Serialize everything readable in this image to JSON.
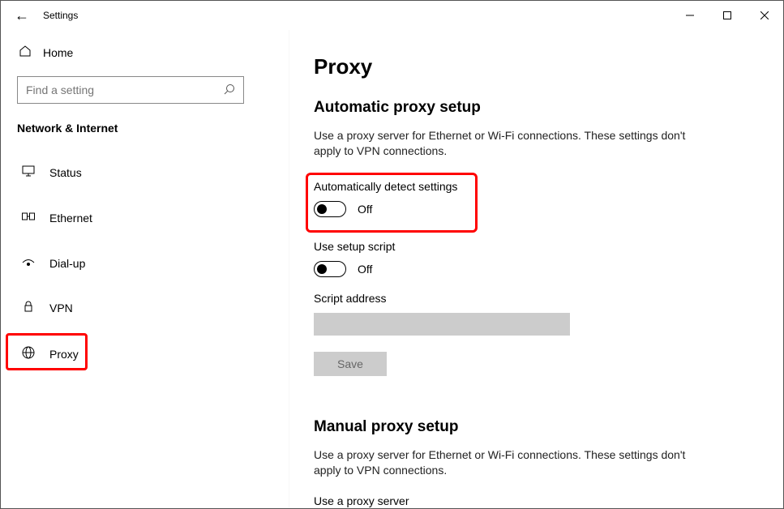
{
  "titlebar": {
    "title": "Settings"
  },
  "sidebar": {
    "home": "Home",
    "search_placeholder": "Find a setting",
    "category": "Network & Internet",
    "items": [
      {
        "label": "Status"
      },
      {
        "label": "Ethernet"
      },
      {
        "label": "Dial-up"
      },
      {
        "label": "VPN"
      },
      {
        "label": "Proxy"
      }
    ]
  },
  "page": {
    "title": "Proxy",
    "auto": {
      "heading": "Automatic proxy setup",
      "desc": "Use a proxy server for Ethernet or Wi-Fi connections. These settings don't apply to VPN connections.",
      "detect_label": "Automatically detect settings",
      "detect_state": "Off",
      "script_label": "Use setup script",
      "script_state": "Off",
      "address_label": "Script address",
      "save_label": "Save"
    },
    "manual": {
      "heading": "Manual proxy setup",
      "desc": "Use a proxy server for Ethernet or Wi-Fi connections. These settings don't apply to VPN connections.",
      "use_label": "Use a proxy server"
    }
  }
}
